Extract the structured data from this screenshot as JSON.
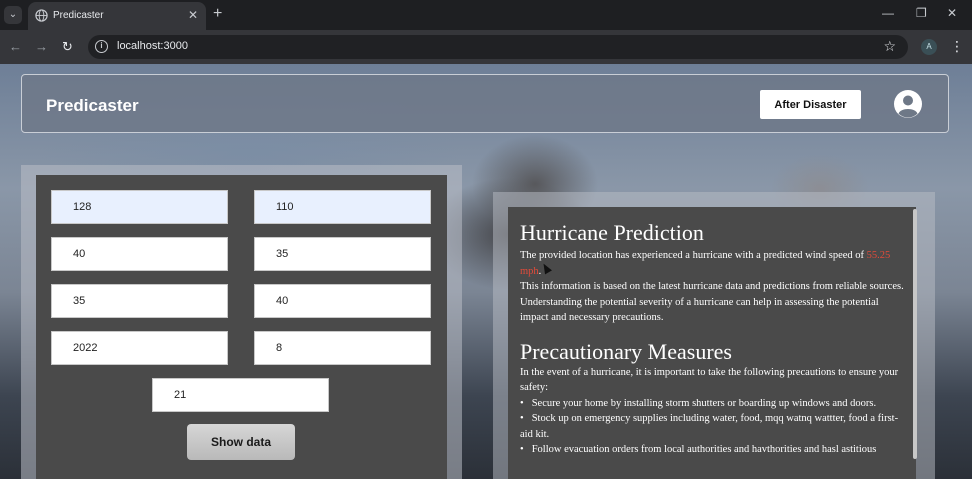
{
  "browser": {
    "tab_title": "Predicaster",
    "url": "localhost:3000",
    "profile_initial": "A"
  },
  "header": {
    "brand": "Predicaster",
    "after_disaster_label": "After Disaster"
  },
  "form": {
    "fields": [
      "128",
      "110",
      "40",
      "35",
      "35",
      "40",
      "2022",
      "8",
      "21"
    ],
    "show_data_label": "Show data"
  },
  "result": {
    "title": "Hurricane Prediction",
    "intro_prefix": "The provided location has experienced a hurricane with a predicted wind speed of ",
    "wind_speed": "55.25 mph",
    "intro_suffix": ".",
    "info": "This information is based on the latest hurricane data and predictions from reliable sources. Understanding the potential severity of a hurricane can help in assessing the potential impact and necessary precautions.",
    "measures_title": "Precautionary Measures",
    "measures_intro": "In the event of a hurricane, it is important to take the following precautions to ensure your safety:",
    "measures": [
      "Secure your home by installing storm shutters or boarding up windows and doors.",
      "Stock up on emergency supplies including water, food, mqq watnq wattter, food a first-aid kit.",
      "Follow evacuation orders from local authorities and havthorities and hasl astitious"
    ]
  },
  "colors": {
    "wind_speed": "#e24b3a",
    "panel_dark": "#4a4a4a",
    "autofill_field": "#e8f0fe"
  }
}
